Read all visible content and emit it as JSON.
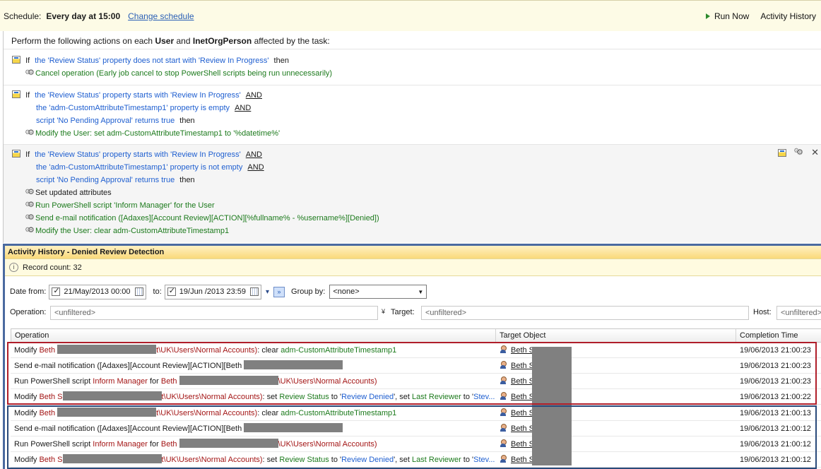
{
  "schedule": {
    "label": "Schedule:",
    "value": "Every day at 15:00",
    "change_link": "Change schedule",
    "run_now": "Run Now",
    "activity_history": "Activity History"
  },
  "rules": {
    "intro_pre": "Perform the following actions on each",
    "intro_obj1": "User",
    "intro_and": "and",
    "intro_obj2": "InetOrgPerson",
    "intro_post": "affected by the task:",
    "if": "If",
    "and": "AND",
    "then": "then",
    "block1": {
      "cond1": "the 'Review Status' property does not start with 'Review In Progress'",
      "action1": "Cancel operation (Early job cancel to stop PowerShell scripts being run unnecessarily)"
    },
    "block2": {
      "cond1": "the 'Review Status' property starts with 'Review In Progress'",
      "cond2": "the 'adm-CustomAttributeTimestamp1' property is empty",
      "cond3": "script 'No Pending Approval' returns true",
      "action1": "Modify the User: set adm-CustomAttributeTimestamp1 to '%datetime%'"
    },
    "block3": {
      "cond1": "the 'Review Status' property starts with 'Review In Progress'",
      "cond2": "the 'adm-CustomAttributeTimestamp1' property is not empty",
      "cond3": "script 'No Pending Approval' returns true",
      "action1": "Set updated attributes",
      "action2": "Run PowerShell script 'Inform Manager' for the User",
      "action3": "Send e-mail notification ([Adaxes][Account Review][ACTION][%fullname% - %username%][Denied])",
      "action4": "Modify the User: clear adm-CustomAttributeTimestamp1"
    }
  },
  "history": {
    "title": "Activity History - Denied Review Detection",
    "record_count": "Record count: 32",
    "date_from_label": "Date from:",
    "date_from": "21/May/2013 00:00",
    "to_label": "to:",
    "date_to": "19/Jun /2013 23:59",
    "group_by_label": "Group by:",
    "group_by_value": "<none>",
    "operation_label": "Operation:",
    "operation_filter": "<unfiltered>",
    "target_label": "Target:",
    "target_filter": "<unfiltered>",
    "host_label": "Host:",
    "host_filter": "<unfiltered>",
    "columns": [
      "Operation",
      "Target Object",
      "Completion Time"
    ],
    "rows": [
      {
        "prefix": "Modify ",
        "user": "Beth ",
        "path": "t\\UK\\Users\\Normal Accounts)",
        "suffix": ": clear ",
        "attr": "adm-CustomAttributeTimestamp1",
        "target": "Beth S",
        "time": "19/06/2013 21:00:23"
      },
      {
        "prefix": "Send e-mail notification ([Adaxes][Account Review][ACTION][Beth ",
        "target": "Beth S",
        "time": "19/06/2013 21:00:23"
      },
      {
        "prefix": "Run PowerShell script ",
        "script": "Inform Manager",
        "for": " for ",
        "user": "Beth ",
        "path": "\\UK\\Users\\Normal Accounts)",
        "target": "Beth S",
        "time": "19/06/2013 21:00:23"
      },
      {
        "prefix": "Modify ",
        "user": "Beth S",
        "path": "t\\UK\\Users\\Normal Accounts)",
        "suffix": ": set ",
        "attr": "Review Status",
        "to": " to '",
        "val": "Review Denied",
        "rest": "', set ",
        "attr2": "Last Reviewer",
        "to2": " to '",
        "val2": "Stev...",
        "target": "Beth S",
        "time": "19/06/2013 21:00:22"
      },
      {
        "prefix": "Modify ",
        "user": "Beth ",
        "path": "t\\UK\\Users\\Normal Accounts)",
        "suffix": ": clear ",
        "attr": "adm-CustomAttributeTimestamp1",
        "target": "Beth S",
        "time": "19/06/2013 21:00:13"
      },
      {
        "prefix": "Send e-mail notification ([Adaxes][Account Review][ACTION][Beth ",
        "target": "Beth S",
        "time": "19/06/2013 21:00:12"
      },
      {
        "prefix": "Run PowerShell script ",
        "script": "Inform Manager",
        "for": " for ",
        "user": "Beth ",
        "path": "\\UK\\Users\\Normal Accounts)",
        "target": "Beth S",
        "time": "19/06/2013 21:00:12"
      },
      {
        "prefix": "Modify ",
        "user": "Beth S",
        "path": "t\\UK\\Users\\Normal Accounts)",
        "suffix": ": set ",
        "attr": "Review Status",
        "to": " to '",
        "val": "Review Denied",
        "rest": "', set ",
        "attr2": "Last Reviewer",
        "to2": " to '",
        "val2": "Stev...",
        "target": "Beth S",
        "time": "19/06/2013 21:00:12"
      }
    ]
  }
}
